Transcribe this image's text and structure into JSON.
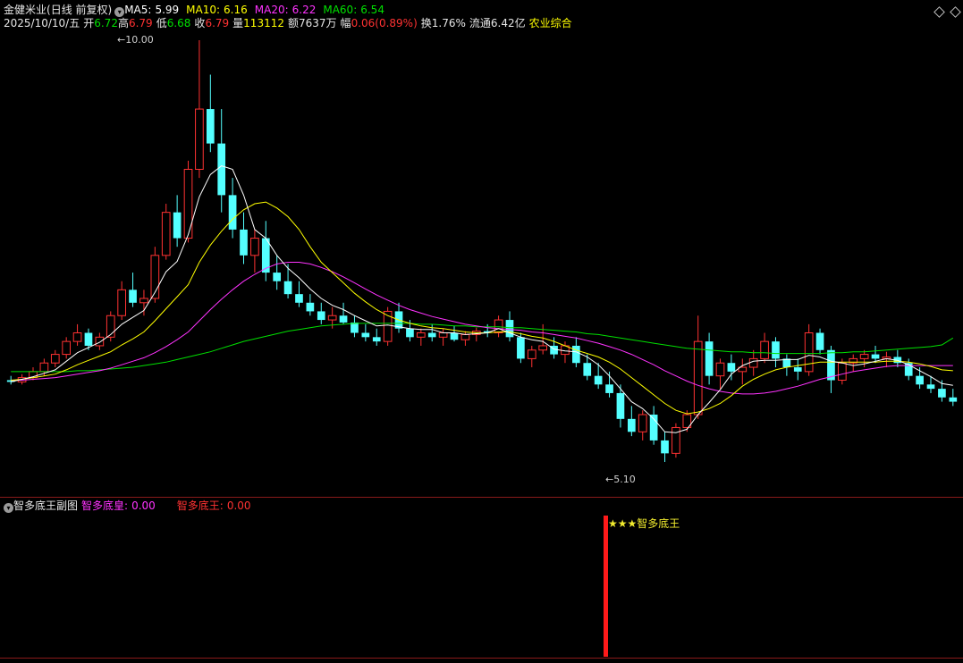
{
  "header": {
    "stock_name": "金健米业",
    "period": "(日线 前复权)",
    "ma5_label": "MA5:",
    "ma5_value": "5.99",
    "ma10_label": "MA10:",
    "ma10_value": "6.16",
    "ma20_label": "MA20:",
    "ma20_value": "6.22",
    "ma60_label": "MA60:",
    "ma60_value": "6.54",
    "date": "2025/10/10/五",
    "open_label": "开",
    "open_value": "6.72",
    "high_label": "高",
    "high_value": "6.79",
    "low_label": "低",
    "low_value": "6.68",
    "close_label": "收",
    "close_value": "6.79",
    "volume_label": "量",
    "volume_value": "113112",
    "amount_label": "额",
    "amount_value": "7637万",
    "change_label": "幅",
    "change_value": "0.06(0.89%)",
    "turnover_label": "换",
    "turnover_value": "1.76%",
    "float_label": "流通",
    "float_value": "6.42亿",
    "sector": "农业综合"
  },
  "annotations": {
    "max_price": "10.00",
    "min_price": "5.10"
  },
  "sub_panel": {
    "title": "智多底王副图",
    "line1_label": "智多底皇:",
    "line1_value": "0.00",
    "line2_label": "智多底王:",
    "line2_value": "0.00",
    "signal_text": "★★★智多底王"
  },
  "colors": {
    "up": "#ff3232",
    "down": "#54ffff",
    "ma5": "#ffffff",
    "ma10": "#ffff00",
    "ma20": "#ff33ff",
    "ma60": "#00e000",
    "label_gray": "#c8c8c8",
    "signal": "#ff1a1a"
  },
  "chart_data": {
    "type": "candlestick",
    "ylim": [
      5.1,
      10.0
    ],
    "ohlc": [
      [
        6.05,
        6.1,
        6.0,
        6.03
      ],
      [
        6.03,
        6.12,
        6.0,
        6.08
      ],
      [
        6.08,
        6.2,
        6.05,
        6.15
      ],
      [
        6.15,
        6.3,
        6.1,
        6.25
      ],
      [
        6.25,
        6.4,
        6.2,
        6.35
      ],
      [
        6.35,
        6.55,
        6.3,
        6.5
      ],
      [
        6.5,
        6.7,
        6.45,
        6.6
      ],
      [
        6.6,
        6.65,
        6.4,
        6.45
      ],
      [
        6.45,
        6.6,
        6.4,
        6.55
      ],
      [
        6.55,
        6.85,
        6.5,
        6.8
      ],
      [
        6.8,
        7.2,
        6.75,
        7.1
      ],
      [
        7.1,
        7.3,
        6.9,
        6.95
      ],
      [
        6.95,
        7.1,
        6.8,
        7.0
      ],
      [
        7.0,
        7.6,
        6.95,
        7.5
      ],
      [
        7.5,
        8.1,
        7.45,
        8.0
      ],
      [
        8.0,
        8.2,
        7.6,
        7.7
      ],
      [
        7.7,
        8.6,
        7.65,
        8.5
      ],
      [
        8.5,
        10.0,
        8.4,
        9.2
      ],
      [
        9.2,
        9.6,
        8.7,
        8.8
      ],
      [
        8.8,
        9.2,
        8.0,
        8.2
      ],
      [
        8.2,
        8.4,
        7.7,
        7.8
      ],
      [
        7.8,
        8.0,
        7.4,
        7.5
      ],
      [
        7.5,
        7.8,
        7.3,
        7.7
      ],
      [
        7.7,
        7.9,
        7.2,
        7.3
      ],
      [
        7.3,
        7.5,
        7.1,
        7.2
      ],
      [
        7.2,
        7.4,
        7.0,
        7.05
      ],
      [
        7.05,
        7.2,
        6.9,
        6.95
      ],
      [
        6.95,
        7.05,
        6.8,
        6.85
      ],
      [
        6.85,
        6.95,
        6.7,
        6.75
      ],
      [
        6.75,
        6.9,
        6.65,
        6.8
      ],
      [
        6.8,
        6.95,
        6.7,
        6.72
      ],
      [
        6.72,
        6.8,
        6.55,
        6.6
      ],
      [
        6.6,
        6.7,
        6.5,
        6.55
      ],
      [
        6.55,
        6.65,
        6.45,
        6.5
      ],
      [
        6.5,
        6.9,
        6.45,
        6.85
      ],
      [
        6.85,
        6.95,
        6.6,
        6.65
      ],
      [
        6.65,
        6.75,
        6.5,
        6.55
      ],
      [
        6.55,
        6.65,
        6.45,
        6.6
      ],
      [
        6.6,
        6.7,
        6.5,
        6.55
      ],
      [
        6.55,
        6.65,
        6.45,
        6.6
      ],
      [
        6.6,
        6.68,
        6.5,
        6.52
      ],
      [
        6.52,
        6.62,
        6.45,
        6.58
      ],
      [
        6.58,
        6.66,
        6.5,
        6.62
      ],
      [
        6.62,
        6.7,
        6.55,
        6.6
      ],
      [
        6.6,
        6.8,
        6.55,
        6.75
      ],
      [
        6.75,
        6.85,
        6.5,
        6.55
      ],
      [
        6.55,
        6.6,
        6.25,
        6.3
      ],
      [
        6.3,
        6.45,
        6.2,
        6.4
      ],
      [
        6.4,
        6.7,
        6.35,
        6.45
      ],
      [
        6.45,
        6.55,
        6.3,
        6.35
      ],
      [
        6.35,
        6.5,
        6.25,
        6.45
      ],
      [
        6.45,
        6.55,
        6.2,
        6.25
      ],
      [
        6.25,
        6.35,
        6.05,
        6.1
      ],
      [
        6.1,
        6.25,
        5.95,
        6.0
      ],
      [
        6.0,
        6.15,
        5.85,
        5.9
      ],
      [
        5.9,
        6.0,
        5.5,
        5.6
      ],
      [
        5.6,
        5.75,
        5.4,
        5.45
      ],
      [
        5.45,
        5.7,
        5.35,
        5.65
      ],
      [
        5.65,
        5.75,
        5.3,
        5.35
      ],
      [
        5.35,
        5.45,
        5.1,
        5.2
      ],
      [
        5.2,
        5.55,
        5.15,
        5.5
      ],
      [
        5.5,
        5.7,
        5.45,
        5.65
      ],
      [
        5.65,
        6.8,
        5.6,
        6.5
      ],
      [
        6.5,
        6.6,
        6.0,
        6.1
      ],
      [
        6.1,
        6.3,
        5.95,
        6.25
      ],
      [
        6.25,
        6.35,
        6.05,
        6.15
      ],
      [
        6.15,
        6.3,
        6.0,
        6.2
      ],
      [
        6.2,
        6.4,
        6.1,
        6.3
      ],
      [
        6.3,
        6.6,
        6.25,
        6.5
      ],
      [
        6.5,
        6.55,
        6.2,
        6.3
      ],
      [
        6.3,
        6.35,
        6.1,
        6.2
      ],
      [
        6.2,
        6.3,
        6.05,
        6.15
      ],
      [
        6.15,
        6.7,
        6.1,
        6.6
      ],
      [
        6.6,
        6.65,
        6.35,
        6.4
      ],
      [
        6.4,
        6.45,
        5.9,
        6.05
      ],
      [
        6.05,
        6.3,
        6.0,
        6.25
      ],
      [
        6.25,
        6.35,
        6.15,
        6.3
      ],
      [
        6.3,
        6.4,
        6.2,
        6.35
      ],
      [
        6.35,
        6.45,
        6.25,
        6.3
      ],
      [
        6.3,
        6.38,
        6.2,
        6.32
      ],
      [
        6.32,
        6.4,
        6.2,
        6.25
      ],
      [
        6.25,
        6.3,
        6.05,
        6.1
      ],
      [
        6.1,
        6.2,
        5.95,
        6.0
      ],
      [
        6.0,
        6.1,
        5.9,
        5.95
      ],
      [
        5.95,
        6.05,
        5.8,
        5.85
      ],
      [
        5.85,
        5.95,
        5.75,
        5.8
      ]
    ],
    "ma5": [
      6.03,
      6.06,
      6.09,
      6.13,
      6.17,
      6.27,
      6.37,
      6.43,
      6.49,
      6.58,
      6.7,
      6.78,
      6.86,
      7.07,
      7.31,
      7.43,
      7.74,
      8.18,
      8.44,
      8.54,
      8.5,
      8.2,
      7.8,
      7.7,
      7.5,
      7.35,
      7.24,
      7.11,
      7.0,
      6.92,
      6.87,
      6.8,
      6.74,
      6.68,
      6.69,
      6.67,
      6.65,
      6.64,
      6.64,
      6.6,
      6.6,
      6.58,
      6.59,
      6.6,
      6.65,
      6.6,
      6.55,
      6.52,
      6.5,
      6.41,
      6.39,
      6.38,
      6.32,
      6.23,
      6.1,
      5.95,
      5.8,
      5.72,
      5.6,
      5.45,
      5.44,
      5.48,
      5.65,
      5.79,
      5.94,
      6.12,
      6.22,
      6.27,
      6.28,
      6.28,
      6.29,
      6.29,
      6.34,
      6.32,
      6.27,
      6.25,
      6.22,
      6.24,
      6.27,
      6.3,
      6.28,
      6.23,
      6.16,
      6.09,
      6.01,
      5.99
    ],
    "ma10": [
      6.05,
      6.06,
      6.08,
      6.1,
      6.12,
      6.17,
      6.23,
      6.28,
      6.33,
      6.38,
      6.46,
      6.53,
      6.61,
      6.74,
      6.88,
      7.02,
      7.16,
      7.42,
      7.62,
      7.78,
      7.92,
      8.03,
      8.1,
      8.12,
      8.05,
      7.95,
      7.8,
      7.6,
      7.42,
      7.3,
      7.18,
      7.06,
      6.96,
      6.87,
      6.8,
      6.75,
      6.71,
      6.68,
      6.66,
      6.65,
      6.63,
      6.61,
      6.6,
      6.6,
      6.61,
      6.61,
      6.59,
      6.56,
      6.54,
      6.5,
      6.45,
      6.4,
      6.36,
      6.32,
      6.26,
      6.18,
      6.08,
      5.98,
      5.88,
      5.78,
      5.7,
      5.66,
      5.68,
      5.72,
      5.78,
      5.87,
      5.98,
      6.06,
      6.12,
      6.17,
      6.2,
      6.22,
      6.24,
      6.26,
      6.26,
      6.26,
      6.26,
      6.26,
      6.26,
      6.27,
      6.27,
      6.26,
      6.24,
      6.21,
      6.17,
      6.16
    ],
    "ma20": [
      6.05,
      6.05,
      6.06,
      6.07,
      6.08,
      6.1,
      6.12,
      6.14,
      6.16,
      6.19,
      6.23,
      6.27,
      6.31,
      6.37,
      6.44,
      6.52,
      6.61,
      6.74,
      6.87,
      6.99,
      7.1,
      7.2,
      7.28,
      7.35,
      7.4,
      7.42,
      7.42,
      7.4,
      7.36,
      7.31,
      7.25,
      7.18,
      7.11,
      7.04,
      6.98,
      6.92,
      6.87,
      6.83,
      6.79,
      6.76,
      6.73,
      6.7,
      6.68,
      6.66,
      6.65,
      6.64,
      6.63,
      6.61,
      6.6,
      6.58,
      6.56,
      6.54,
      6.51,
      6.48,
      6.44,
      6.4,
      6.35,
      6.29,
      6.23,
      6.16,
      6.1,
      6.04,
      5.99,
      5.95,
      5.92,
      5.9,
      5.89,
      5.89,
      5.9,
      5.92,
      5.95,
      5.98,
      6.02,
      6.06,
      6.09,
      6.12,
      6.15,
      6.17,
      6.19,
      6.21,
      6.22,
      6.22,
      6.22,
      6.22,
      6.22,
      6.22
    ],
    "ma60": [
      6.15,
      6.15,
      6.15,
      6.15,
      6.15,
      6.15,
      6.16,
      6.16,
      6.17,
      6.18,
      6.19,
      6.2,
      6.22,
      6.24,
      6.26,
      6.29,
      6.32,
      6.35,
      6.38,
      6.42,
      6.46,
      6.5,
      6.53,
      6.56,
      6.59,
      6.62,
      6.64,
      6.66,
      6.68,
      6.69,
      6.7,
      6.71,
      6.71,
      6.71,
      6.71,
      6.71,
      6.71,
      6.7,
      6.7,
      6.69,
      6.68,
      6.68,
      6.67,
      6.67,
      6.67,
      6.66,
      6.66,
      6.65,
      6.64,
      6.63,
      6.62,
      6.61,
      6.59,
      6.58,
      6.56,
      6.54,
      6.52,
      6.5,
      6.48,
      6.46,
      6.44,
      6.42,
      6.41,
      6.4,
      6.39,
      6.38,
      6.38,
      6.37,
      6.37,
      6.36,
      6.36,
      6.36,
      6.36,
      6.36,
      6.37,
      6.37,
      6.38,
      6.38,
      6.39,
      6.4,
      6.41,
      6.42,
      6.43,
      6.44,
      6.46,
      6.54
    ]
  }
}
